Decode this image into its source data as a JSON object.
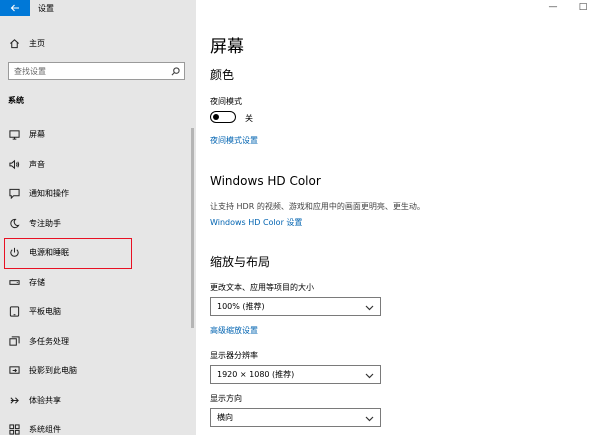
{
  "window": {
    "title": "设置",
    "controls": {
      "minimize": "—",
      "maximize": "□"
    }
  },
  "sidebar": {
    "home_label": "主页",
    "search_placeholder": "查找设置",
    "section_label": "系统",
    "items": [
      {
        "label": "屏幕",
        "icon": "monitor-icon"
      },
      {
        "label": "声音",
        "icon": "speaker-icon"
      },
      {
        "label": "通知和操作",
        "icon": "notification-icon"
      },
      {
        "label": "专注助手",
        "icon": "moon-icon"
      },
      {
        "label": "电源和睡眠",
        "icon": "power-icon"
      },
      {
        "label": "存储",
        "icon": "storage-icon"
      },
      {
        "label": "平板电脑",
        "icon": "tablet-icon"
      },
      {
        "label": "多任务处理",
        "icon": "multitask-icon"
      },
      {
        "label": "投影到此电脑",
        "icon": "project-icon"
      },
      {
        "label": "体验共享",
        "icon": "share-icon"
      },
      {
        "label": "系统组件",
        "icon": "components-icon"
      }
    ],
    "highlighted_item": "电源和睡眠",
    "highlight_color": "#e81123"
  },
  "main": {
    "title": "屏幕",
    "color_section": {
      "heading": "颜色",
      "night_mode_label": "夜间模式",
      "night_mode_state": "关",
      "night_mode_link": "夜间模式设置"
    },
    "hdr_section": {
      "heading": "Windows HD Color",
      "description": "让支持 HDR 的视频、游戏和应用中的画面更明亮、更生动。",
      "link": "Windows HD Color 设置"
    },
    "scale_section": {
      "heading": "缩放与布局",
      "scale_label": "更改文本、应用等项目的大小",
      "scale_value": "100% (推荐)",
      "advanced_link": "高级缩放设置",
      "resolution_label": "显示器分辨率",
      "resolution_value": "1920 × 1080 (推荐)",
      "orientation_label": "显示方向",
      "orientation_value": "横向"
    }
  },
  "colors": {
    "accent": "#0078d7",
    "link": "#0063b1",
    "sidebar_bg": "#e6e6e6"
  }
}
